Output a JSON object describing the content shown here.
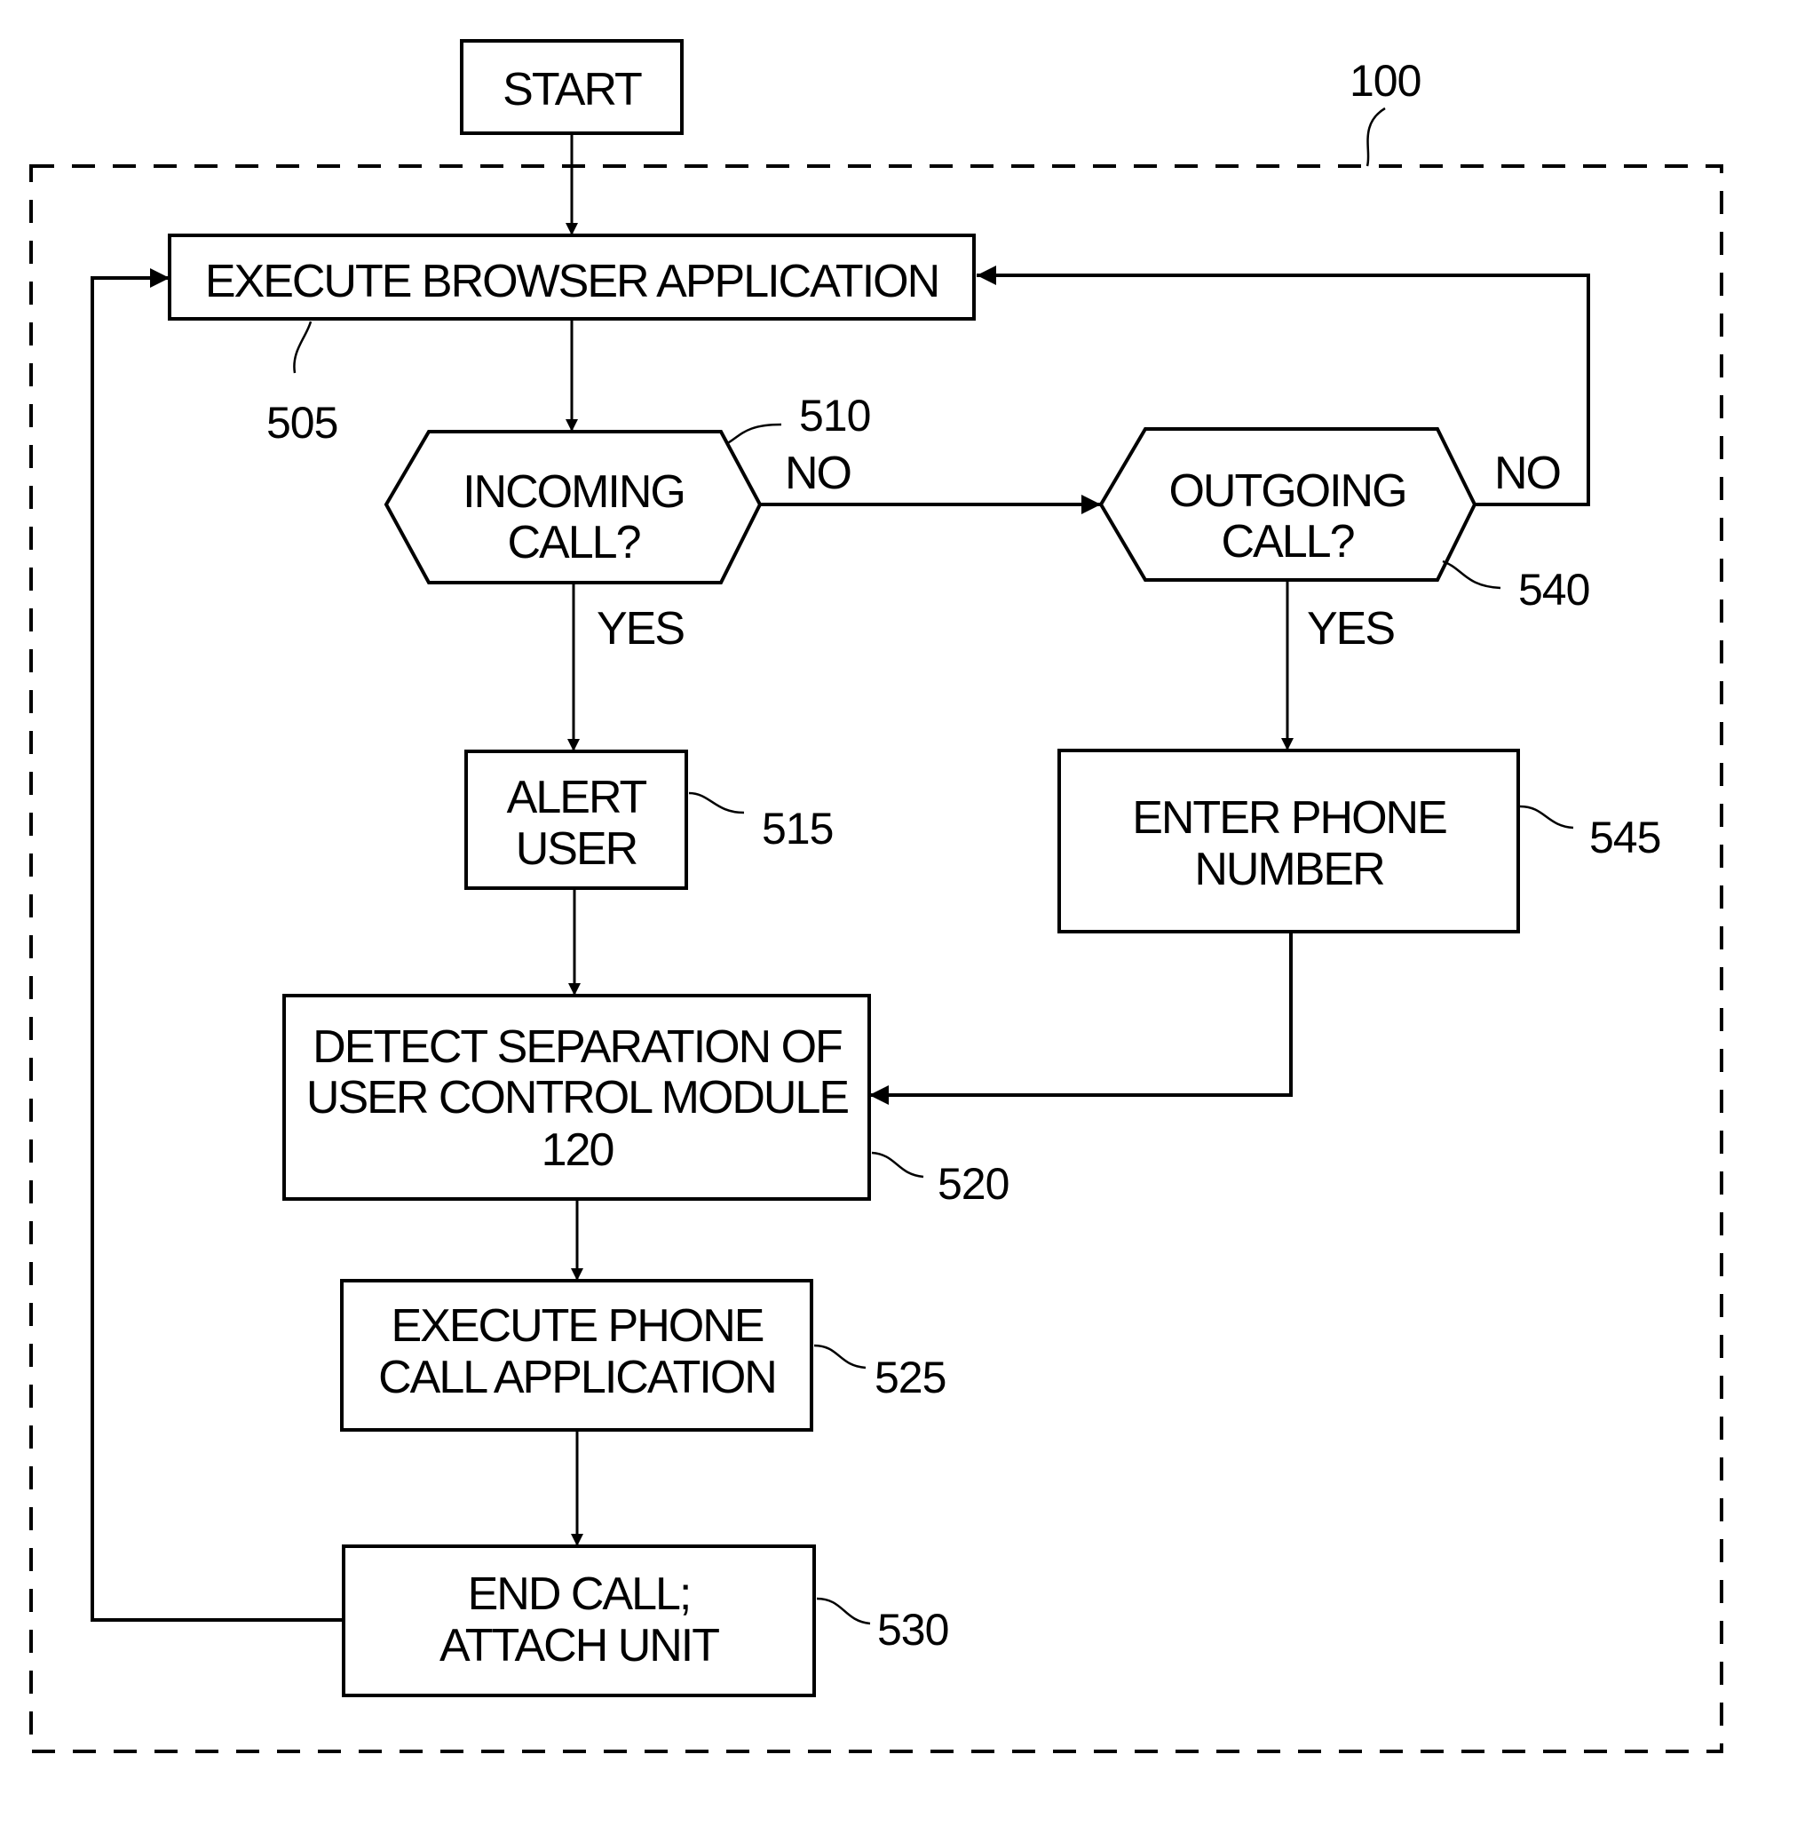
{
  "diagram": {
    "type": "flowchart",
    "boundary_ref": "100",
    "nodes": {
      "start": {
        "text": [
          "START"
        ]
      },
      "execute_browser": {
        "text": [
          "EXECUTE BROWSER APPLICATION"
        ],
        "ref": "505"
      },
      "incoming_call": {
        "text": [
          "INCOMING",
          "CALL?"
        ],
        "ref": "510"
      },
      "outgoing_call": {
        "text": [
          "OUTGOING",
          "CALL?"
        ],
        "ref": "540"
      },
      "alert_user": {
        "text": [
          "ALERT",
          "USER"
        ],
        "ref": "515"
      },
      "enter_phone": {
        "text": [
          "ENTER PHONE",
          "NUMBER"
        ],
        "ref": "545"
      },
      "detect_separation": {
        "text": [
          "DETECT SEPARATION OF",
          "USER CONTROL MODULE",
          "120"
        ],
        "ref": "520"
      },
      "execute_phone": {
        "text": [
          "EXECUTE PHONE",
          "CALL APPLICATION"
        ],
        "ref": "525"
      },
      "end_call": {
        "text": [
          "END CALL;",
          "ATTACH UNIT"
        ],
        "ref": "530"
      }
    },
    "edge_labels": {
      "incoming_no": "NO",
      "incoming_yes": "YES",
      "outgoing_no": "NO",
      "outgoing_yes": "YES"
    },
    "edges": [
      {
        "from": "start",
        "to": "execute_browser"
      },
      {
        "from": "execute_browser",
        "to": "incoming_call"
      },
      {
        "from": "incoming_call",
        "to": "outgoing_call",
        "label": "NO"
      },
      {
        "from": "incoming_call",
        "to": "alert_user",
        "label": "YES"
      },
      {
        "from": "outgoing_call",
        "to": "execute_browser",
        "label": "NO"
      },
      {
        "from": "outgoing_call",
        "to": "enter_phone",
        "label": "YES"
      },
      {
        "from": "alert_user",
        "to": "detect_separation"
      },
      {
        "from": "enter_phone",
        "to": "detect_separation"
      },
      {
        "from": "detect_separation",
        "to": "execute_phone"
      },
      {
        "from": "execute_phone",
        "to": "end_call"
      },
      {
        "from": "end_call",
        "to": "execute_browser"
      }
    ]
  }
}
